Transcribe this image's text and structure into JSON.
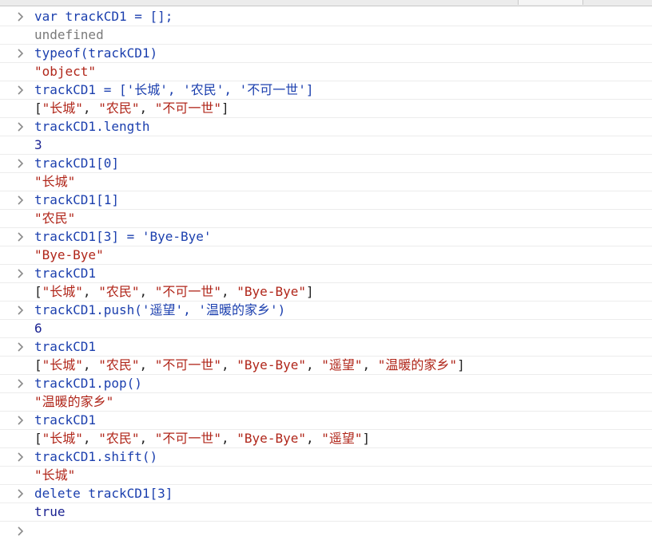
{
  "console": {
    "lines": [
      {
        "kind": "input",
        "text": "var trackCD1 = [];"
      },
      {
        "kind": "undefined",
        "text": "undefined"
      },
      {
        "kind": "input",
        "text": "typeof(trackCD1)"
      },
      {
        "kind": "string",
        "text": "\"object\""
      },
      {
        "kind": "input",
        "text": "trackCD1 = ['长城', '农民', '不可一世']"
      },
      {
        "kind": "array",
        "items": [
          "长城",
          "农民",
          "不可一世"
        ]
      },
      {
        "kind": "input",
        "text": "trackCD1.length"
      },
      {
        "kind": "number",
        "text": "3"
      },
      {
        "kind": "input",
        "text": "trackCD1[0]"
      },
      {
        "kind": "string",
        "text": "\"长城\""
      },
      {
        "kind": "input",
        "text": "trackCD1[1]"
      },
      {
        "kind": "string",
        "text": "\"农民\""
      },
      {
        "kind": "input",
        "text": "trackCD1[3] = 'Bye-Bye'"
      },
      {
        "kind": "string",
        "text": "\"Bye-Bye\""
      },
      {
        "kind": "input",
        "text": "trackCD1"
      },
      {
        "kind": "array",
        "items": [
          "长城",
          "农民",
          "不可一世",
          "Bye-Bye"
        ]
      },
      {
        "kind": "input",
        "text": "trackCD1.push('遥望', '温暖的家乡')"
      },
      {
        "kind": "number",
        "text": "6"
      },
      {
        "kind": "input",
        "text": "trackCD1"
      },
      {
        "kind": "array",
        "items": [
          "长城",
          "农民",
          "不可一世",
          "Bye-Bye",
          "遥望",
          "温暖的家乡"
        ]
      },
      {
        "kind": "input",
        "text": "trackCD1.pop()"
      },
      {
        "kind": "string",
        "text": "\"温暖的家乡\""
      },
      {
        "kind": "input",
        "text": "trackCD1"
      },
      {
        "kind": "array",
        "items": [
          "长城",
          "农民",
          "不可一世",
          "Bye-Bye",
          "遥望"
        ]
      },
      {
        "kind": "input",
        "text": "trackCD1.shift()"
      },
      {
        "kind": "string",
        "text": "\"长城\""
      },
      {
        "kind": "input",
        "text": "delete trackCD1[3]"
      },
      {
        "kind": "bool",
        "text": "true"
      }
    ]
  },
  "icons": {
    "input_prompt": "chevron-right-icon",
    "bottom_prompt": "chevron-right-icon"
  },
  "colors": {
    "input_text": "#1b3fae",
    "string_value": "#b0261a",
    "number_value": "#1b2392",
    "undefined_value": "#7a7a7a",
    "prompt": "#8a8a8a"
  }
}
